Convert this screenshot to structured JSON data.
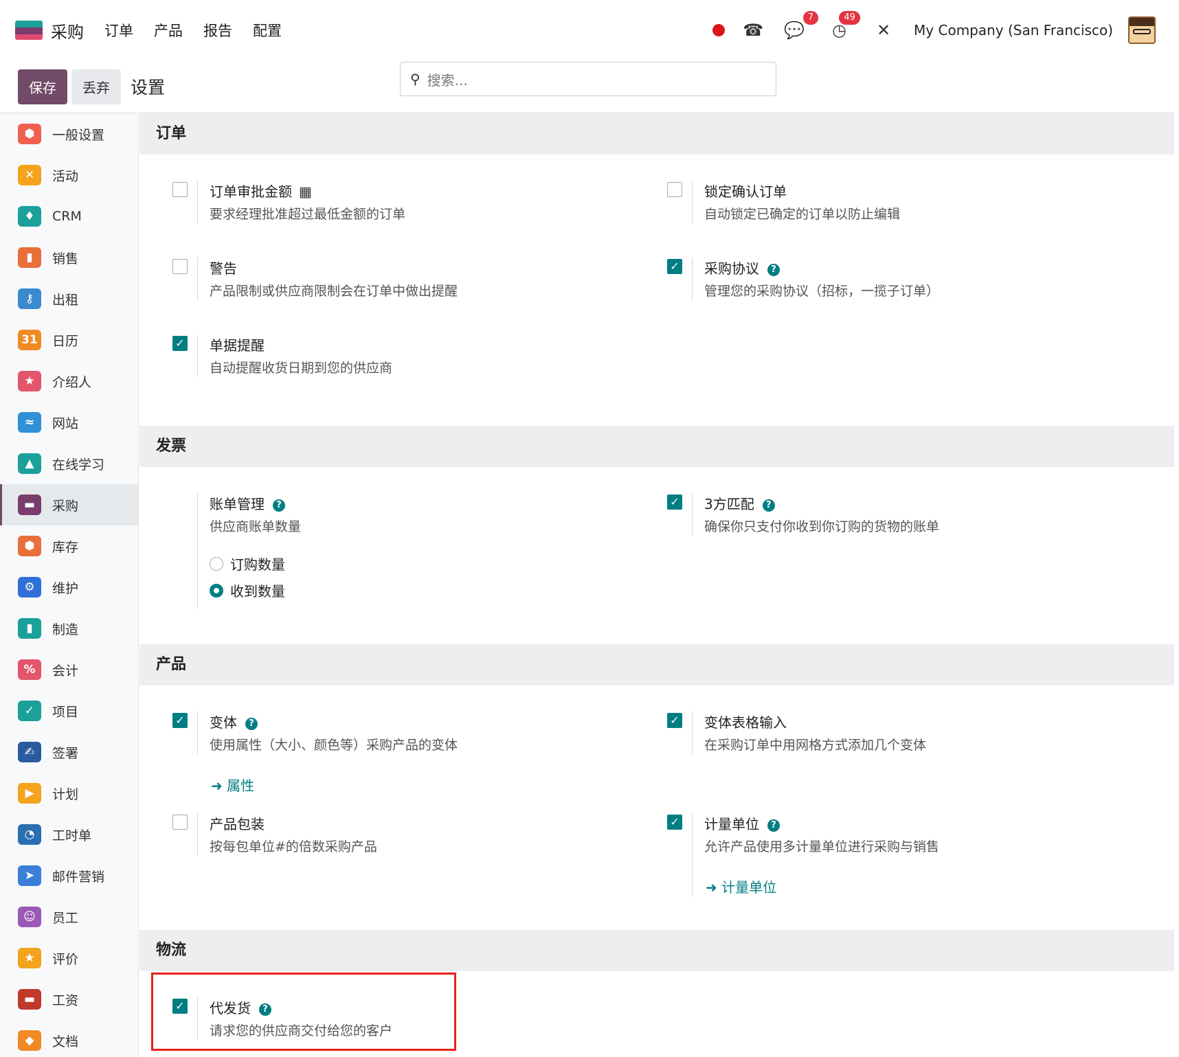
{
  "nav": {
    "app_name": "采购",
    "menu": [
      "订单",
      "产品",
      "报告",
      "配置"
    ],
    "messages_badge": "7",
    "activities_badge": "49",
    "company": "My Company (San Francisco)"
  },
  "control": {
    "save": "保存",
    "discard": "丢弃",
    "title": "设置",
    "search_placeholder": "搜索..."
  },
  "sidebar": {
    "items": [
      {
        "label": "一般设置",
        "color": "#f06050",
        "glyph": "⬢"
      },
      {
        "label": "活动",
        "color": "#f4a31c",
        "glyph": "✕"
      },
      {
        "label": "CRM",
        "color": "#1ba09a",
        "glyph": "♦"
      },
      {
        "label": "销售",
        "color": "#e86f3a",
        "glyph": "▮"
      },
      {
        "label": "出租",
        "color": "#3a8ad0",
        "glyph": "⚷"
      },
      {
        "label": "日历",
        "color": "#f08a24",
        "glyph": "31"
      },
      {
        "label": "介绍人",
        "color": "#e3556a",
        "glyph": "★"
      },
      {
        "label": "网站",
        "color": "#2f8fd8",
        "glyph": "≈"
      },
      {
        "label": "在线学习",
        "color": "#1ba09a",
        "glyph": "▲"
      },
      {
        "label": "采购",
        "color": "#7a3c6c",
        "glyph": "▬"
      },
      {
        "label": "库存",
        "color": "#e86f3a",
        "glyph": "⬢"
      },
      {
        "label": "维护",
        "color": "#2f6fd8",
        "glyph": "⚙"
      },
      {
        "label": "制造",
        "color": "#1ba09a",
        "glyph": "▮"
      },
      {
        "label": "会计",
        "color": "#e3556a",
        "glyph": "%"
      },
      {
        "label": "项目",
        "color": "#1ba09a",
        "glyph": "✓"
      },
      {
        "label": "签署",
        "color": "#2a5aa0",
        "glyph": "✍"
      },
      {
        "label": "计划",
        "color": "#f4a31c",
        "glyph": "▶"
      },
      {
        "label": "工时单",
        "color": "#2a6fb0",
        "glyph": "◔"
      },
      {
        "label": "邮件营销",
        "color": "#3a7fd8",
        "glyph": "➤"
      },
      {
        "label": "员工",
        "color": "#9b59b6",
        "glyph": "☺"
      },
      {
        "label": "评价",
        "color": "#f4a31c",
        "glyph": "★"
      },
      {
        "label": "工资",
        "color": "#c0392b",
        "glyph": "▬"
      },
      {
        "label": "文档",
        "color": "#f08a24",
        "glyph": "◆"
      }
    ],
    "active_index": 9
  },
  "sections": {
    "orders": {
      "head": "订单",
      "approval": {
        "title": "订单审批金额",
        "desc": "要求经理批准超过最低金额的订单",
        "checked": false
      },
      "lock": {
        "title": "锁定确认订单",
        "desc": "自动锁定已确定的订单以防止编辑",
        "checked": false
      },
      "warning": {
        "title": "警告",
        "desc": "产品限制或供应商限制会在订单中做出提醒",
        "checked": false
      },
      "agreements": {
        "title": "采购协议",
        "desc": "管理您的采购协议（招标，一揽子订单）",
        "checked": true
      },
      "reminder": {
        "title": "单据提醒",
        "desc": "自动提醒收货日期到您的供应商",
        "checked": true
      }
    },
    "invoice": {
      "head": "发票",
      "bill": {
        "title": "账单管理",
        "desc": "供应商账单数量",
        "opt1": "订购数量",
        "opt2": "收到数量",
        "selected": "收到数量"
      },
      "match": {
        "title": "3方匹配",
        "desc": "确保你只支付你收到你订购的货物的账单",
        "checked": true
      }
    },
    "products": {
      "head": "产品",
      "variants": {
        "title": "变体",
        "desc": "使用属性（大小、颜色等）采购产品的变体",
        "link": "属性",
        "checked": true
      },
      "grid": {
        "title": "变体表格输入",
        "desc": "在采购订单中用网格方式添加几个变体",
        "checked": true
      },
      "packaging": {
        "title": "产品包装",
        "desc": "按每包单位#的倍数采购产品",
        "checked": false
      },
      "uom": {
        "title": "计量单位",
        "desc": "允许产品使用多计量单位进行采购与销售",
        "link": "计量单位",
        "checked": true
      }
    },
    "logistics": {
      "head": "物流",
      "dropship": {
        "title": "代发货",
        "desc": "请求您的供应商交付给您的客户",
        "checked": true
      }
    }
  }
}
